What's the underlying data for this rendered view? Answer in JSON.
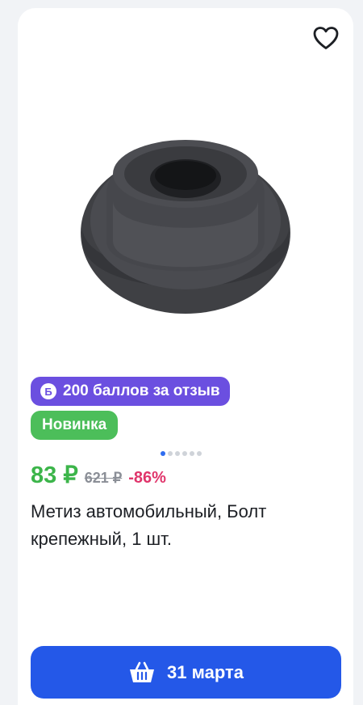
{
  "card": {
    "favorite_icon": "heart-icon",
    "badges": {
      "points_icon_letter": "Б",
      "points_label": "200 баллов за отзыв",
      "new_label": "Новинка"
    },
    "gallery": {
      "total_images": 6,
      "active_index": 0
    },
    "price": {
      "current": "83 ₽",
      "old": "621 ₽",
      "discount": "-86%"
    },
    "title": "Метиз автомобильный, Болт крепежный, 1 шт.",
    "cart_button": {
      "icon": "basket-icon",
      "label": "31 марта"
    },
    "colors": {
      "price": "#3cb54a",
      "discount": "#e0356b",
      "points_badge": "#6b4fe0",
      "new_badge": "#4cbe5a",
      "button": "#2458e8"
    }
  }
}
